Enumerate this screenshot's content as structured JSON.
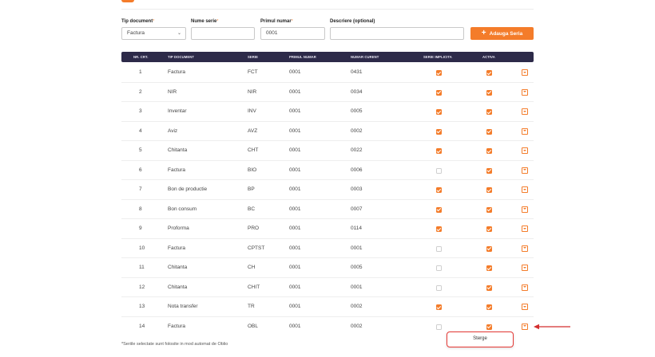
{
  "form": {
    "tip_document": {
      "label": "Tip document",
      "required_mark": "*",
      "value": "Factura"
    },
    "nume_serie": {
      "label": "Nume serie",
      "required_mark": "*",
      "value": ""
    },
    "primul_numar": {
      "label": "Primul numar",
      "required_mark": "*",
      "value": "0001"
    },
    "descriere": {
      "label": "Descriere (optional)",
      "value": ""
    },
    "add_button_label": "Adauga Seria"
  },
  "table": {
    "headers": [
      "NR. CRT.",
      "TIP DOCUMENT",
      "SERIE",
      "PRIMUL NUMAR",
      "NUMAR CURENT",
      "SERIE IMPLICITA",
      "ACTIVA"
    ],
    "rows": [
      {
        "nr": "1",
        "tip": "Factura",
        "serie": "FCT",
        "primul": "0001",
        "curent": "0431",
        "implicita": true,
        "activa": true
      },
      {
        "nr": "2",
        "tip": "NIR",
        "serie": "NIR",
        "primul": "0001",
        "curent": "0034",
        "implicita": true,
        "activa": true
      },
      {
        "nr": "3",
        "tip": "Inventar",
        "serie": "INV",
        "primul": "0001",
        "curent": "0005",
        "implicita": true,
        "activa": true
      },
      {
        "nr": "4",
        "tip": "Aviz",
        "serie": "AVZ",
        "primul": "0001",
        "curent": "0002",
        "implicita": true,
        "activa": true
      },
      {
        "nr": "5",
        "tip": "Chitanta",
        "serie": "CHT",
        "primul": "0001",
        "curent": "0022",
        "implicita": true,
        "activa": true
      },
      {
        "nr": "6",
        "tip": "Factura",
        "serie": "BIO",
        "primul": "0001",
        "curent": "0006",
        "implicita": false,
        "activa": true
      },
      {
        "nr": "7",
        "tip": "Bon de productie",
        "serie": "BP",
        "primul": "0001",
        "curent": "0003",
        "implicita": true,
        "activa": true
      },
      {
        "nr": "8",
        "tip": "Bon consum",
        "serie": "BC",
        "primul": "0001",
        "curent": "0007",
        "implicita": true,
        "activa": true
      },
      {
        "nr": "9",
        "tip": "Proforma",
        "serie": "PRO",
        "primul": "0001",
        "curent": "0114",
        "implicita": true,
        "activa": true
      },
      {
        "nr": "10",
        "tip": "Factura",
        "serie": "CPTST",
        "primul": "0001",
        "curent": "0001",
        "implicita": false,
        "activa": true
      },
      {
        "nr": "11",
        "tip": "Chitanta",
        "serie": "CH",
        "primul": "0001",
        "curent": "0005",
        "implicita": false,
        "activa": true
      },
      {
        "nr": "12",
        "tip": "Chitanta",
        "serie": "CHIT",
        "primul": "0001",
        "curent": "0001",
        "implicita": false,
        "activa": true
      },
      {
        "nr": "13",
        "tip": "Nota transfer",
        "serie": "TR",
        "primul": "0001",
        "curent": "0002",
        "implicita": true,
        "activa": true
      },
      {
        "nr": "14",
        "tip": "Factura",
        "serie": "OBL",
        "primul": "0001",
        "curent": "0002",
        "implicita": false,
        "activa": true
      }
    ]
  },
  "footnote": "*Seriile selectate sunt folosite in mod automat de Oblio",
  "row_menu": {
    "delete_label": "Sterge"
  },
  "colors": {
    "accent": "#f47c2a",
    "header_bg": "#2d2a49",
    "highlight": "#e53935"
  },
  "icons": {
    "dropdown": "chevron-down-icon",
    "add": "plus-icon",
    "row_action": "row-dropdown-icon",
    "annotation": "arrow-left-icon"
  }
}
